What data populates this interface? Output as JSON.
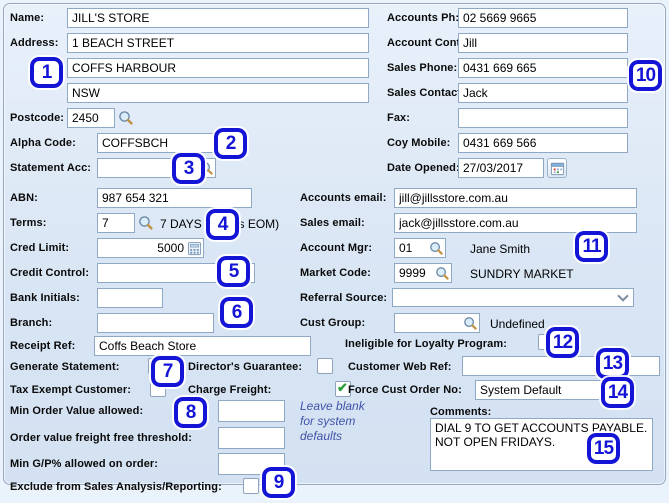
{
  "fields": {
    "name": {
      "label": "Name:",
      "value": "JILL'S STORE"
    },
    "address1": {
      "label": "Address:",
      "value": "1 BEACH STREET"
    },
    "address2": {
      "value": "COFFS HARBOUR"
    },
    "address3": {
      "value": "NSW"
    },
    "postcode": {
      "label": "Postcode:",
      "value": "2450"
    },
    "alpha_code": {
      "label": "Alpha Code:",
      "value": "COFFSBCH"
    },
    "statement_acc": {
      "label": "Statement Acc:",
      "value": ""
    },
    "abn": {
      "label": "ABN:",
      "value": "987 654 321"
    },
    "terms": {
      "label": "Terms:",
      "value": "7",
      "description": "7 DAYS (7 days EOM)"
    },
    "cred_limit": {
      "label": "Cred Limit:",
      "value": "5000"
    },
    "credit_control": {
      "label": "Credit Control:",
      "value": ""
    },
    "bank_initials": {
      "label": "Bank Initials:",
      "value": ""
    },
    "branch": {
      "label": "Branch:",
      "value": ""
    },
    "receipt_ref": {
      "label": "Receipt Ref:",
      "value": "Coffs Beach Store"
    },
    "generate_statement": {
      "label": "Generate Statement:",
      "checked": true
    },
    "directors_guarantee": {
      "label": "Director's Guarantee:",
      "checked": false
    },
    "tax_exempt": {
      "label": "Tax Exempt Customer:",
      "checked": false
    },
    "charge_freight": {
      "label": "Charge Freight:",
      "checked": true
    },
    "min_order_value": {
      "label": "Min Order Value allowed:",
      "value": ""
    },
    "freight_free_threshold": {
      "label": "Order value freight free threshold:",
      "value": ""
    },
    "min_gp": {
      "label": "Min G/P% allowed on order:",
      "value": ""
    },
    "exclude_sales_analysis": {
      "label": "Exclude from Sales Analysis/Reporting:",
      "checked": false
    },
    "accounts_ph": {
      "label": "Accounts Ph:",
      "value": "02 5669 9665"
    },
    "account_cont": {
      "label": "Account Cont:",
      "value": "Jill"
    },
    "sales_phone": {
      "label": "Sales Phone:",
      "value": "0431 669 665"
    },
    "sales_contact": {
      "label": "Sales Contact:",
      "value": "Jack"
    },
    "fax": {
      "label": "Fax:",
      "value": ""
    },
    "coy_mobile": {
      "label": "Coy Mobile:",
      "value": "0431 669 566"
    },
    "date_opened": {
      "label": "Date Opened:",
      "value": "27/03/2017"
    },
    "accounts_email": {
      "label": "Accounts email:",
      "value": "jill@jillsstore.com.au"
    },
    "sales_email": {
      "label": "Sales email:",
      "value": "jack@jillsstore.com.au"
    },
    "account_mgr": {
      "label": "Account Mgr:",
      "value": "01",
      "display": "Jane Smith"
    },
    "market_code": {
      "label": "Market Code:",
      "value": "9999",
      "display": "SUNDRY MARKET"
    },
    "referral_source": {
      "label": "Referral Source:",
      "value": ""
    },
    "cust_group": {
      "label": "Cust Group:",
      "value": "",
      "display": "Undefined"
    },
    "loyalty_ineligible": {
      "label": "Ineligible for Loyalty Program:",
      "checked": false
    },
    "customer_web_ref": {
      "label": "Customer Web Ref:",
      "value": ""
    },
    "force_cust_order_no": {
      "label": "Force Cust Order No:",
      "value": "System Default"
    },
    "comments": {
      "label": "Comments:",
      "value": "DIAL 9 TO GET ACCOUNTS PAYABLE.\nNOT OPEN FRIDAYS."
    }
  },
  "hint": {
    "text": "Leave blank for system defaults"
  },
  "callouts": [
    "1",
    "2",
    "3",
    "4",
    "5",
    "6",
    "7",
    "8",
    "9",
    "10",
    "11",
    "12",
    "13",
    "14",
    "15"
  ],
  "colors": {
    "callout_blue": "#1414d6",
    "check_green": "#2f9e3c",
    "panel_bg": "#d8e5f4",
    "field_border": "#8fa9c4",
    "hint_blue": "#4053a8"
  }
}
